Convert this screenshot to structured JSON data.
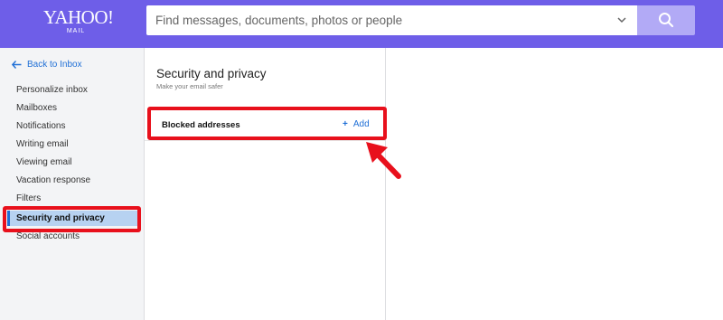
{
  "header": {
    "logo_main": "YAHOO!",
    "logo_sub": "MAIL",
    "search_placeholder": "Find messages, documents, photos or people",
    "colors": {
      "bar": "#6E5EE8",
      "search_button": "#B2AAF6"
    }
  },
  "sidebar": {
    "back_label": "Back to Inbox",
    "items": [
      {
        "label": "Personalize inbox"
      },
      {
        "label": "Mailboxes"
      },
      {
        "label": "Notifications"
      },
      {
        "label": "Writing email"
      },
      {
        "label": "Viewing email"
      },
      {
        "label": "Vacation response"
      },
      {
        "label": "Filters"
      },
      {
        "label": "Security and privacy",
        "active": true
      },
      {
        "label": "Social accounts"
      }
    ]
  },
  "panel": {
    "title": "Security and privacy",
    "subtitle": "Make your email safer",
    "row_label": "Blocked addresses",
    "add_label": "Add"
  },
  "annotation_color": "#E8101C"
}
